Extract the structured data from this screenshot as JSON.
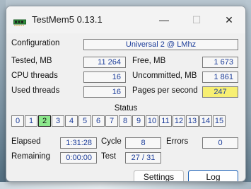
{
  "window": {
    "title": "TestMem5  0.13.1",
    "controls": {
      "minimize": "—",
      "maximize": "☐",
      "close": "✕"
    }
  },
  "config": {
    "label": "Configuration",
    "value": "Universal 2 @ LMhz"
  },
  "stats_left": [
    {
      "label": "Tested, MB",
      "value": "11 264"
    },
    {
      "label": "CPU threads",
      "value": "16"
    },
    {
      "label": "Used threads",
      "value": "16"
    }
  ],
  "stats_right": [
    {
      "label": "Free, MB",
      "value": "1 673"
    },
    {
      "label": "Uncommitted, MB",
      "value": "1 861"
    },
    {
      "label": "Pages per second",
      "value": "247"
    }
  ],
  "status": {
    "title": "Status",
    "cells": [
      "0",
      "1",
      "2",
      "3",
      "4",
      "5",
      "6",
      "7",
      "8",
      "9",
      "10",
      "11",
      "12",
      "13",
      "14",
      "15"
    ],
    "active": "2"
  },
  "progress": {
    "elapsed_label": "Elapsed",
    "elapsed_value": "1:31:28",
    "remaining_label": "Remaining",
    "remaining_value": "0:00:00",
    "cycle_label": "Cycle",
    "cycle_value": "8",
    "test_label": "Test",
    "test_value": "27 / 31",
    "errors_label": "Errors",
    "errors_value": "0"
  },
  "buttons": {
    "settings": "Settings",
    "log": "Log"
  },
  "colors": {
    "value_text": "#1c3d9a",
    "highlight": "#f7ef72",
    "active_cell": "#8ce88c",
    "log_button_border": "#1a5fb4"
  }
}
